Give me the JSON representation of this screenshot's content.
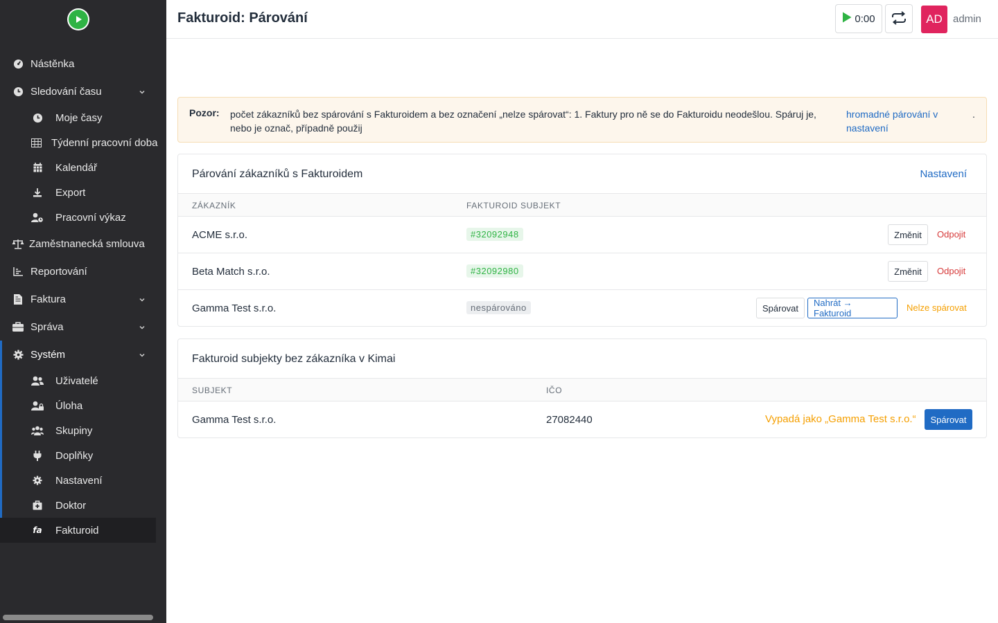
{
  "sidebar": {
    "items": [
      {
        "label": "Nástěnka",
        "icon": "dashboard-icon"
      },
      {
        "label": "Sledování času",
        "icon": "clock-icon"
      },
      {
        "label": "Moje časy",
        "icon": "clock-icon"
      },
      {
        "label": "Týdenní pracovní doba",
        "icon": "table-icon"
      },
      {
        "label": "Kalendář",
        "icon": "calendar-icon"
      },
      {
        "label": "Export",
        "icon": "download-icon"
      },
      {
        "label": "Pracovní výkaz",
        "icon": "user-clock-icon"
      },
      {
        "label": "Zaměstnanecká smlouva",
        "icon": "scale-icon"
      },
      {
        "label": "Reportování",
        "icon": "chart-icon"
      },
      {
        "label": "Faktura",
        "icon": "invoice-icon"
      },
      {
        "label": "Správa",
        "icon": "briefcase-icon"
      },
      {
        "label": "Systém",
        "icon": "gear-icon"
      },
      {
        "label": "Uživatelé",
        "icon": "users-icon"
      },
      {
        "label": "Úloha",
        "icon": "user-lock-icon"
      },
      {
        "label": "Skupiny",
        "icon": "group-icon"
      },
      {
        "label": "Doplňky",
        "icon": "plug-icon"
      },
      {
        "label": "Nastavení",
        "icon": "gear-icon"
      },
      {
        "label": "Doktor",
        "icon": "medkit-icon"
      },
      {
        "label": "Fakturoid",
        "icon": "fakturoid-icon"
      }
    ],
    "accent_color": "#206bc4"
  },
  "header": {
    "title": "Fakturoid: Párování",
    "timer": "0:00",
    "avatar_initials": "AD",
    "avatar_color": "#e0245e",
    "user_name": "admin"
  },
  "alert": {
    "label": "Pozor:",
    "text": "počet zákazníků bez spárování s Fakturoidem a bez označení „nelze spárovat“: 1. Faktury pro ně se do Fakturoidu neodešlou. Spáruj je, nebo je označ, případně použij",
    "link": "hromadné párování v nastavení",
    "trailing": "."
  },
  "pairing_card": {
    "title": "Párování zákazníků s Fakturoidem",
    "settings_link": "Nastavení",
    "columns": [
      "Zákazník",
      "Fakturoid subjekt"
    ],
    "rows": [
      {
        "customer": "ACME s.r.o.",
        "subject": "#32092948",
        "change": "Změnit",
        "disconnect": "Odpojit"
      },
      {
        "customer": "Beta Match s.r.o.",
        "subject": "#32092980",
        "change": "Změnit",
        "disconnect": "Odpojit"
      },
      {
        "customer": "Gamma Test s.r.o.",
        "subject": "nespárováno",
        "pair": "Spárovat",
        "upload": "Nahrát → Fakturoid",
        "cannot_pair": "Nelze spárovat"
      }
    ]
  },
  "subjects_card": {
    "title": "Fakturoid subjekty bez zákazníka v Kimai",
    "columns": [
      "Subjekt",
      "IČO"
    ],
    "rows": [
      {
        "subject": "Gamma Test s.r.o.",
        "ico": "27082440",
        "hint": "Vypadá jako „Gamma Test s.r.o.“",
        "pair": "Spárovat"
      }
    ]
  }
}
